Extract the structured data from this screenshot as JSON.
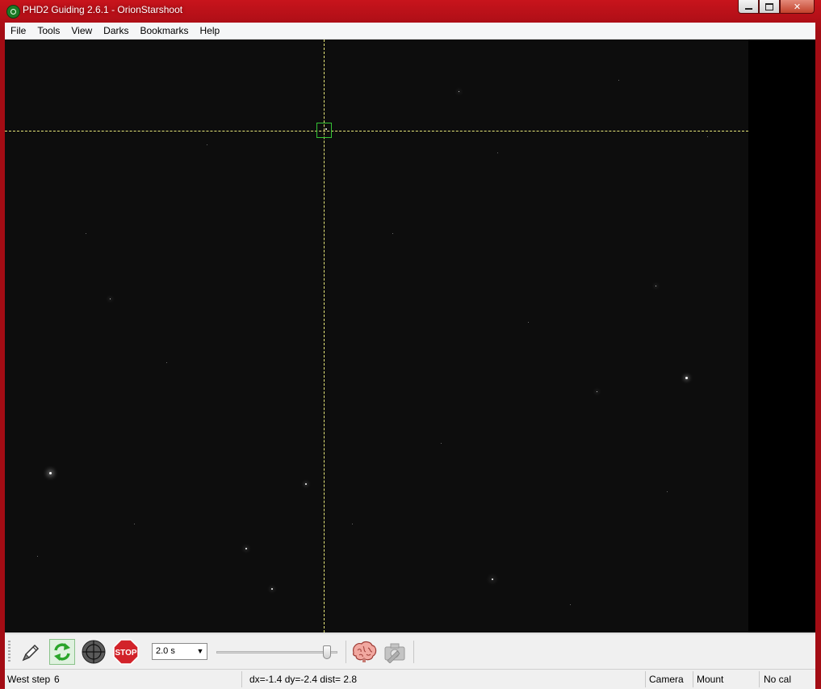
{
  "window": {
    "title": "PHD2 Guiding 2.6.1 - OrionStarshoot",
    "min_icon": "minimize-icon",
    "max_icon": "maximize-icon",
    "close_icon": "close-icon"
  },
  "menu": {
    "items": [
      {
        "label": "File"
      },
      {
        "label": "Tools"
      },
      {
        "label": "View"
      },
      {
        "label": "Darks"
      },
      {
        "label": "Bookmarks"
      },
      {
        "label": "Help"
      }
    ]
  },
  "toolbar": {
    "connect_icon": "connect-equipment-icon",
    "loop_icon": "loop-exposures-icon",
    "guide_icon": "guide-target-icon",
    "stop_label": "STOP",
    "exposure_value": "2.0 s",
    "brain_icon": "brain-icon",
    "camera_settings_icon": "camera-settings-icon"
  },
  "status": {
    "message": "West step",
    "step_number": "6",
    "offset": "dx=-1.4 dy=-2.4 dist= 2.8",
    "camera": "Camera",
    "mount": "Mount",
    "calibration": "No cal"
  },
  "colors": {
    "frame": "#b0121a",
    "crosshair": "#e8e87a",
    "selection": "#34c234",
    "stop": "#d2232a"
  }
}
